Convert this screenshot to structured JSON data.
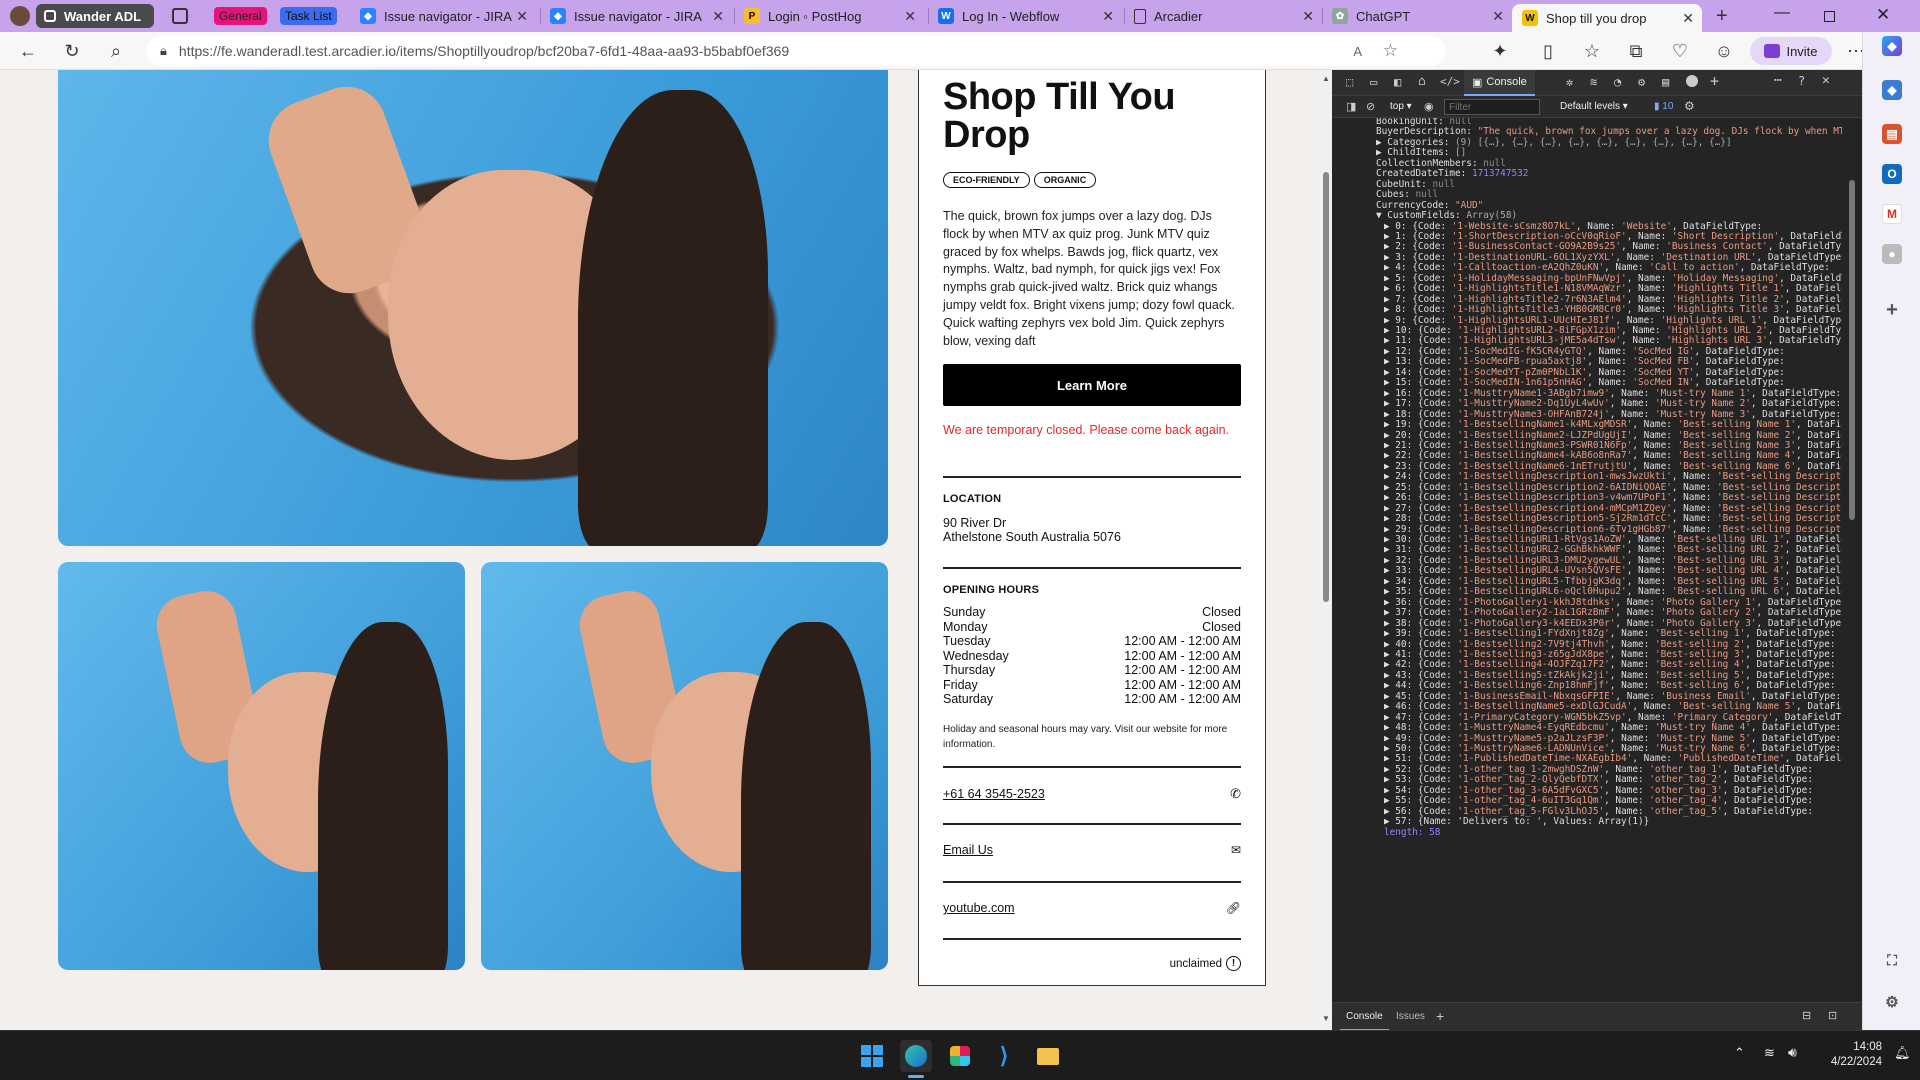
{
  "browser": {
    "profile": "Wander ADL",
    "tabs": [
      {
        "label": "General",
        "kind": "group",
        "color": "#e8137a"
      },
      {
        "label": "Task List",
        "kind": "group",
        "color": "#3b6cf0"
      },
      {
        "label": "Issue navigator - JIRA",
        "icon": "jira-icon"
      },
      {
        "label": "Issue navigator - JIRA",
        "icon": "jira-icon"
      },
      {
        "label": "Login ◦ PostHog",
        "icon": "posthog-icon"
      },
      {
        "label": "Log In - Webflow",
        "icon": "webflow-icon"
      },
      {
        "label": "Arcadier",
        "icon": "page-icon"
      },
      {
        "label": "ChatGPT",
        "icon": "chatgpt-icon"
      },
      {
        "label": "Shop till you drop",
        "icon": "w-icon",
        "active": true
      }
    ],
    "url": "https://fe.wanderadl.test.arcadier.io/items/Shoptillyoudrop/bcf20ba7-6fd1-48aa-aa93-b5babf0ef369",
    "invite_label": "Invite"
  },
  "listing": {
    "title": "Shop Till You Drop",
    "tags": [
      "ECO-FRIENDLY",
      "ORGANIC"
    ],
    "description": "The quick, brown fox jumps over a lazy dog. DJs flock by when MTV ax quiz prog. Junk MTV quiz graced by fox whelps. Bawds jog, flick quartz, vex nymphs. Waltz, bad nymph, for quick jigs vex! Fox nymphs grab quick-jived waltz. Brick quiz whangs jumpy veldt fox. Bright vixens jump; dozy fowl quack. Quick wafting zephyrs vex bold Jim. Quick zephyrs blow, vexing daft",
    "cta_label": "Learn More",
    "closed_notice": "We are temporary closed. Please come back again.",
    "location_label": "LOCATION",
    "address_line1": "90 River Dr",
    "address_line2": "Athelstone South Australia 5076",
    "hours_label": "OPENING HOURS",
    "hours": [
      {
        "day": "Sunday",
        "time": "Closed"
      },
      {
        "day": "Monday",
        "time": "Closed"
      },
      {
        "day": "Tuesday",
        "time": "12:00 AM - 12:00 AM"
      },
      {
        "day": "Wednesday",
        "time": "12:00 AM - 12:00 AM"
      },
      {
        "day": "Thursday",
        "time": "12:00 AM - 12:00 AM"
      },
      {
        "day": "Friday",
        "time": "12:00 AM - 12:00 AM"
      },
      {
        "day": "Saturday",
        "time": "12:00 AM - 12:00 AM"
      }
    ],
    "hours_note": "Holiday and seasonal hours may vary. Visit our website for more information.",
    "phone": "+61 64 3545-2523",
    "email_label": "Email Us",
    "website": "youtube.com",
    "unclaimed_label": "unclaimed"
  },
  "devtools": {
    "tab_console": "Console",
    "context": "top",
    "filter_placeholder": "Filter",
    "levels": "Default levels",
    "issue_count": "10",
    "bottom_tabs": [
      "Console",
      "Issues"
    ],
    "header_lines": [
      {
        "k": "BookingUnit: ",
        "v": "null",
        "c": "nul",
        "indent": 0
      },
      {
        "k": "BuyerDescription: ",
        "v": "\"The quick, brown fox jumps over a lazy dog. DJs flock by when MTV ax",
        "c": "str",
        "indent": 0
      },
      {
        "k": "▶ Categories: ",
        "v": "(9) [{…}, {…}, {…}, {…}, {…}, {…}, {…}, {…}, {…}]",
        "c": "arr",
        "indent": 0
      },
      {
        "k": "▶ ChildItems: ",
        "v": "[]",
        "c": "arr",
        "indent": 0
      },
      {
        "k": "CollectionMembers: ",
        "v": "null",
        "c": "nul",
        "indent": 0
      },
      {
        "k": "CreatedDateTime: ",
        "v": "1713747532",
        "c": "num",
        "indent": 0
      },
      {
        "k": "CubeUnit: ",
        "v": "null",
        "c": "nul",
        "indent": 0
      },
      {
        "k": "Cubes: ",
        "v": "null",
        "c": "nul",
        "indent": 0
      },
      {
        "k": "CurrencyCode: ",
        "v": "\"AUD\"",
        "c": "str",
        "indent": 0
      },
      {
        "k": "▼ CustomFields: ",
        "v": "Array(58)",
        "c": "arr",
        "indent": 0
      }
    ],
    "custom_fields": [
      [
        "1-Website-sCsmz8O7kL",
        "Website"
      ],
      [
        "1-ShortDescription-oCcV0qRioF",
        "Short Description"
      ],
      [
        "1-BusinessContact-GO9A2B9s25",
        "Business Contact"
      ],
      [
        "1-DestinationURL-6OL1XyzYXL",
        "Destination URL"
      ],
      [
        "1-Calltoaction-eA2QhZ0uKN",
        "Call to action"
      ],
      [
        "1-HolidayMessaging-bpUnFNwVpj",
        "Holiday Messaging"
      ],
      [
        "1-HighlightsTitle1-N18VMAqWzr",
        "Highlights Title 1"
      ],
      [
        "1-HighlightsTitle2-7r6N3AElm4",
        "Highlights Title 2"
      ],
      [
        "1-HighlightsTitle3-YHB0GM8Cr0",
        "Highlights Title 3"
      ],
      [
        "1-HighlightsURL1-UUcHIeJ81f",
        "Highlights URL 1"
      ],
      [
        "1-HighlightsURL2-8iFGpX1zim",
        "Highlights URL 2"
      ],
      [
        "1-HighlightsURL3-jME5a4dTsw",
        "Highlights URL 3"
      ],
      [
        "1-SocMedIG-fK5CR4yGTQ",
        "SocMed IG"
      ],
      [
        "1-SocMedFB-rpua5axtj8",
        "SocMed FB"
      ],
      [
        "1-SocMedYT-pZm0PNbL1K",
        "SocMed YT"
      ],
      [
        "1-SocMedIN-1n61p5nHAG",
        "SocMed IN"
      ],
      [
        "1-MusttryName1-3ABgb7imw9",
        "Must-try Name 1"
      ],
      [
        "1-MusttryName2-Dq1UyL4wUv",
        "Must-try Name 2"
      ],
      [
        "1-MusttryName3-OHFAnB724j",
        "Must-try Name 3"
      ],
      [
        "1-BestsellingName1-k4MLxgMDSR",
        "Best-selling Name 1"
      ],
      [
        "1-BestsellingName2-LJZPdUgUjI",
        "Best-selling Name 2"
      ],
      [
        "1-BestsellingName3-PSWR01N6Fp",
        "Best-selling Name 3"
      ],
      [
        "1-BestsellingName4-kAB6o8nRa7",
        "Best-selling Name 4"
      ],
      [
        "1-BestsellingName6-1nETrutjtU",
        "Best-selling Name 6"
      ],
      [
        "1-BestsellingDescription1-mwsJwzUkti",
        "Best-selling Description 1"
      ],
      [
        "1-BestsellingDescription2-6AIDNiQOAE",
        "Best-selling Description 2"
      ],
      [
        "1-BestsellingDescription3-v4wm7UPoF1",
        "Best-selling Description 3"
      ],
      [
        "1-BestsellingDescription4-mMCpM1ZQey",
        "Best-selling Description 4"
      ],
      [
        "1-BestsellingDescription5-Sj2Rm1dTcC",
        "Best-selling Description 5"
      ],
      [
        "1-BestsellingDescription6-6Tv1gHGb87",
        "Best-selling Description 6"
      ],
      [
        "1-BestsellingURL1-RtVgs1AoZW",
        "Best-selling URL 1"
      ],
      [
        "1-BestsellingURL2-GGhBkhkWWF",
        "Best-selling URL 2"
      ],
      [
        "1-BestsellingURL3-DMU2ygewUL",
        "Best-selling URL 3"
      ],
      [
        "1-BestsellingURL4-UVsn5QVsFE",
        "Best-selling URL 4"
      ],
      [
        "1-BestsellingURL5-TfbbjgK3dq",
        "Best-selling URL 5"
      ],
      [
        "1-BestsellingURL6-oQcl0Hupu2",
        "Best-selling URL 6"
      ],
      [
        "1-PhotoGallery1-kkhJ8tdhks",
        "Photo Gallery 1"
      ],
      [
        "1-PhotoGallery2-1aL1GRzBmF",
        "Photo Gallery 2"
      ],
      [
        "1-PhotoGallery3-k4EEDx3P0r",
        "Photo Gallery 3"
      ],
      [
        "1-Bestselling1-FYdXnjt8Zg",
        "Best-selling 1"
      ],
      [
        "1-Bestselling2-7V9tj4Thvh",
        "Best-selling 2"
      ],
      [
        "1-Bestselling3-z65gJdX8pe",
        "Best-selling 3"
      ],
      [
        "1-Bestselling4-4OJFZq17F2",
        "Best-selling 4"
      ],
      [
        "1-Bestselling5-tZkAkjk2ji",
        "Best-selling 5"
      ],
      [
        "1-Bestselling6-Znp18hmFjf",
        "Best-selling 6"
      ],
      [
        "1-BusinessEmail-NbxqsGFPIE",
        "Business Email"
      ],
      [
        "1-BestsellingName5-exDlGJCudA",
        "Best-selling Name 5"
      ],
      [
        "1-PrimaryCategory-WGN5bkZ5vp",
        "Primary Category"
      ],
      [
        "1-MusttryName4-EyqREdbcmu",
        "Must-try Name 4"
      ],
      [
        "1-MusttryName5-p2aJLzsF3P",
        "Must-try Name 5"
      ],
      [
        "1-MusttryName6-LADNUnVice",
        "Must-try Name 6"
      ],
      [
        "1-PublishedDateTime-NXAEgbIb4",
        "PublishedDateTime"
      ],
      [
        "1-other_tag_1-2mwghDSZnW",
        "other_tag_1"
      ],
      [
        "1-other_tag_2-QlyQebfDTX",
        "other_tag_2"
      ],
      [
        "1-other_tag_3-6A5dFvGXC5",
        "other_tag_3"
      ],
      [
        "1-other_tag_4-6uIT3Gq1Qm",
        "other_tag_4"
      ],
      [
        "1-other_tag_5-FGlv3LhOJ5",
        "other_tag_5"
      ]
    ],
    "field57": "▶ 57: {Name: 'Delivers to: ', Values: Array(1)}",
    "length_line": "length: 58"
  },
  "taskbar": {
    "time": "14:08",
    "date": "4/22/2024"
  },
  "colors": {
    "tabbar": "#c6a3ea",
    "page_bg": "#f3efec",
    "closed_red": "#e3262d",
    "devtools_bg": "#242424"
  }
}
